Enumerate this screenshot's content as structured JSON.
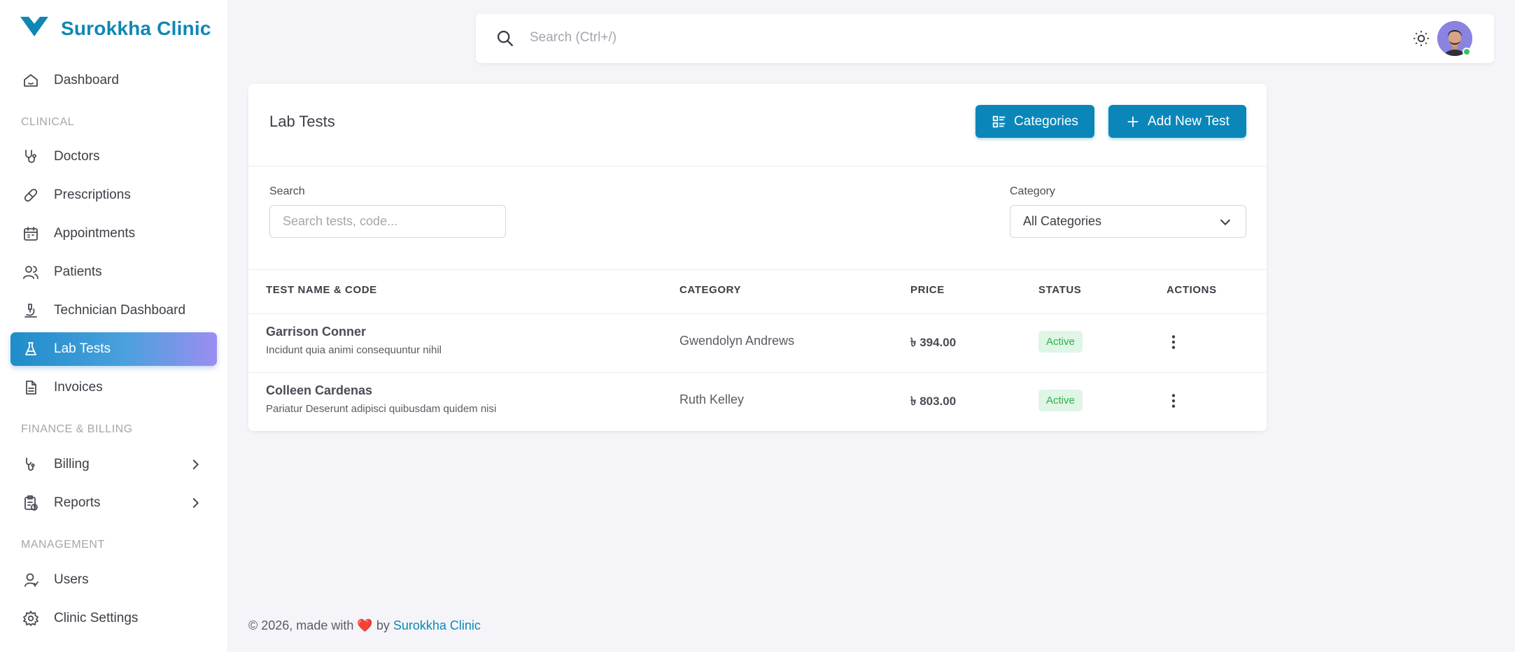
{
  "brand": {
    "name": "Surokkha Clinic",
    "color": "#0f87b3"
  },
  "sidebar": {
    "items": [
      {
        "label": "Dashboard",
        "icon": "home-icon"
      },
      {
        "label": "Doctors",
        "icon": "stethoscope-icon"
      },
      {
        "label": "Prescriptions",
        "icon": "pill-icon"
      },
      {
        "label": "Appointments",
        "icon": "calendar-icon"
      },
      {
        "label": "Patients",
        "icon": "users-icon"
      },
      {
        "label": "Technician Dashboard",
        "icon": "microscope-icon"
      },
      {
        "label": "Lab Tests",
        "icon": "flask-icon",
        "active": true
      },
      {
        "label": "Invoices",
        "icon": "document-icon"
      },
      {
        "label": "Billing",
        "icon": "stethoscope-hook-icon",
        "has_children": true
      },
      {
        "label": "Reports",
        "icon": "clipboard-clock-icon",
        "has_children": true
      },
      {
        "label": "Users",
        "icon": "user-icon"
      },
      {
        "label": "Clinic Settings",
        "icon": "gear-icon"
      }
    ],
    "sections": {
      "clinical": "CLINICAL",
      "finance": "FINANCE & BILLING",
      "management": "MANAGEMENT"
    }
  },
  "topbar": {
    "search_placeholder": "Search (Ctrl+/)",
    "theme_icon": "sun-icon",
    "user_status": "online"
  },
  "page": {
    "title": "Lab Tests",
    "buttons": {
      "categories": "Categories",
      "add_new": "Add New Test"
    },
    "filters": {
      "search_label": "Search",
      "search_placeholder": "Search tests, code...",
      "category_label": "Category",
      "category_value": "All Categories"
    },
    "table": {
      "headers": [
        "TEST NAME & CODE",
        "CATEGORY",
        "PRICE",
        "STATUS",
        "ACTIONS"
      ],
      "rows": [
        {
          "name": "Garrison Conner",
          "desc": "Incidunt quia animi consequuntur nihil",
          "category": "Gwendolyn Andrews",
          "price": "৳ 394.00",
          "status": "Active"
        },
        {
          "name": "Colleen Cardenas",
          "desc": "Pariatur Deserunt adipisci quibusdam quidem nisi",
          "category": "Ruth Kelley",
          "price": "৳ 803.00",
          "status": "Active"
        }
      ]
    }
  },
  "footer": {
    "prefix": "© 2026, made with",
    "heart": "❤️",
    "by": "by",
    "link": "Surokkha Clinic"
  },
  "colors": {
    "accent": "#0a87b8",
    "active_gradient_start": "#1e8dc9",
    "active_gradient_end": "#9b8ef0",
    "badge_bg": "#dff5e5",
    "badge_text": "#2fb04d"
  }
}
